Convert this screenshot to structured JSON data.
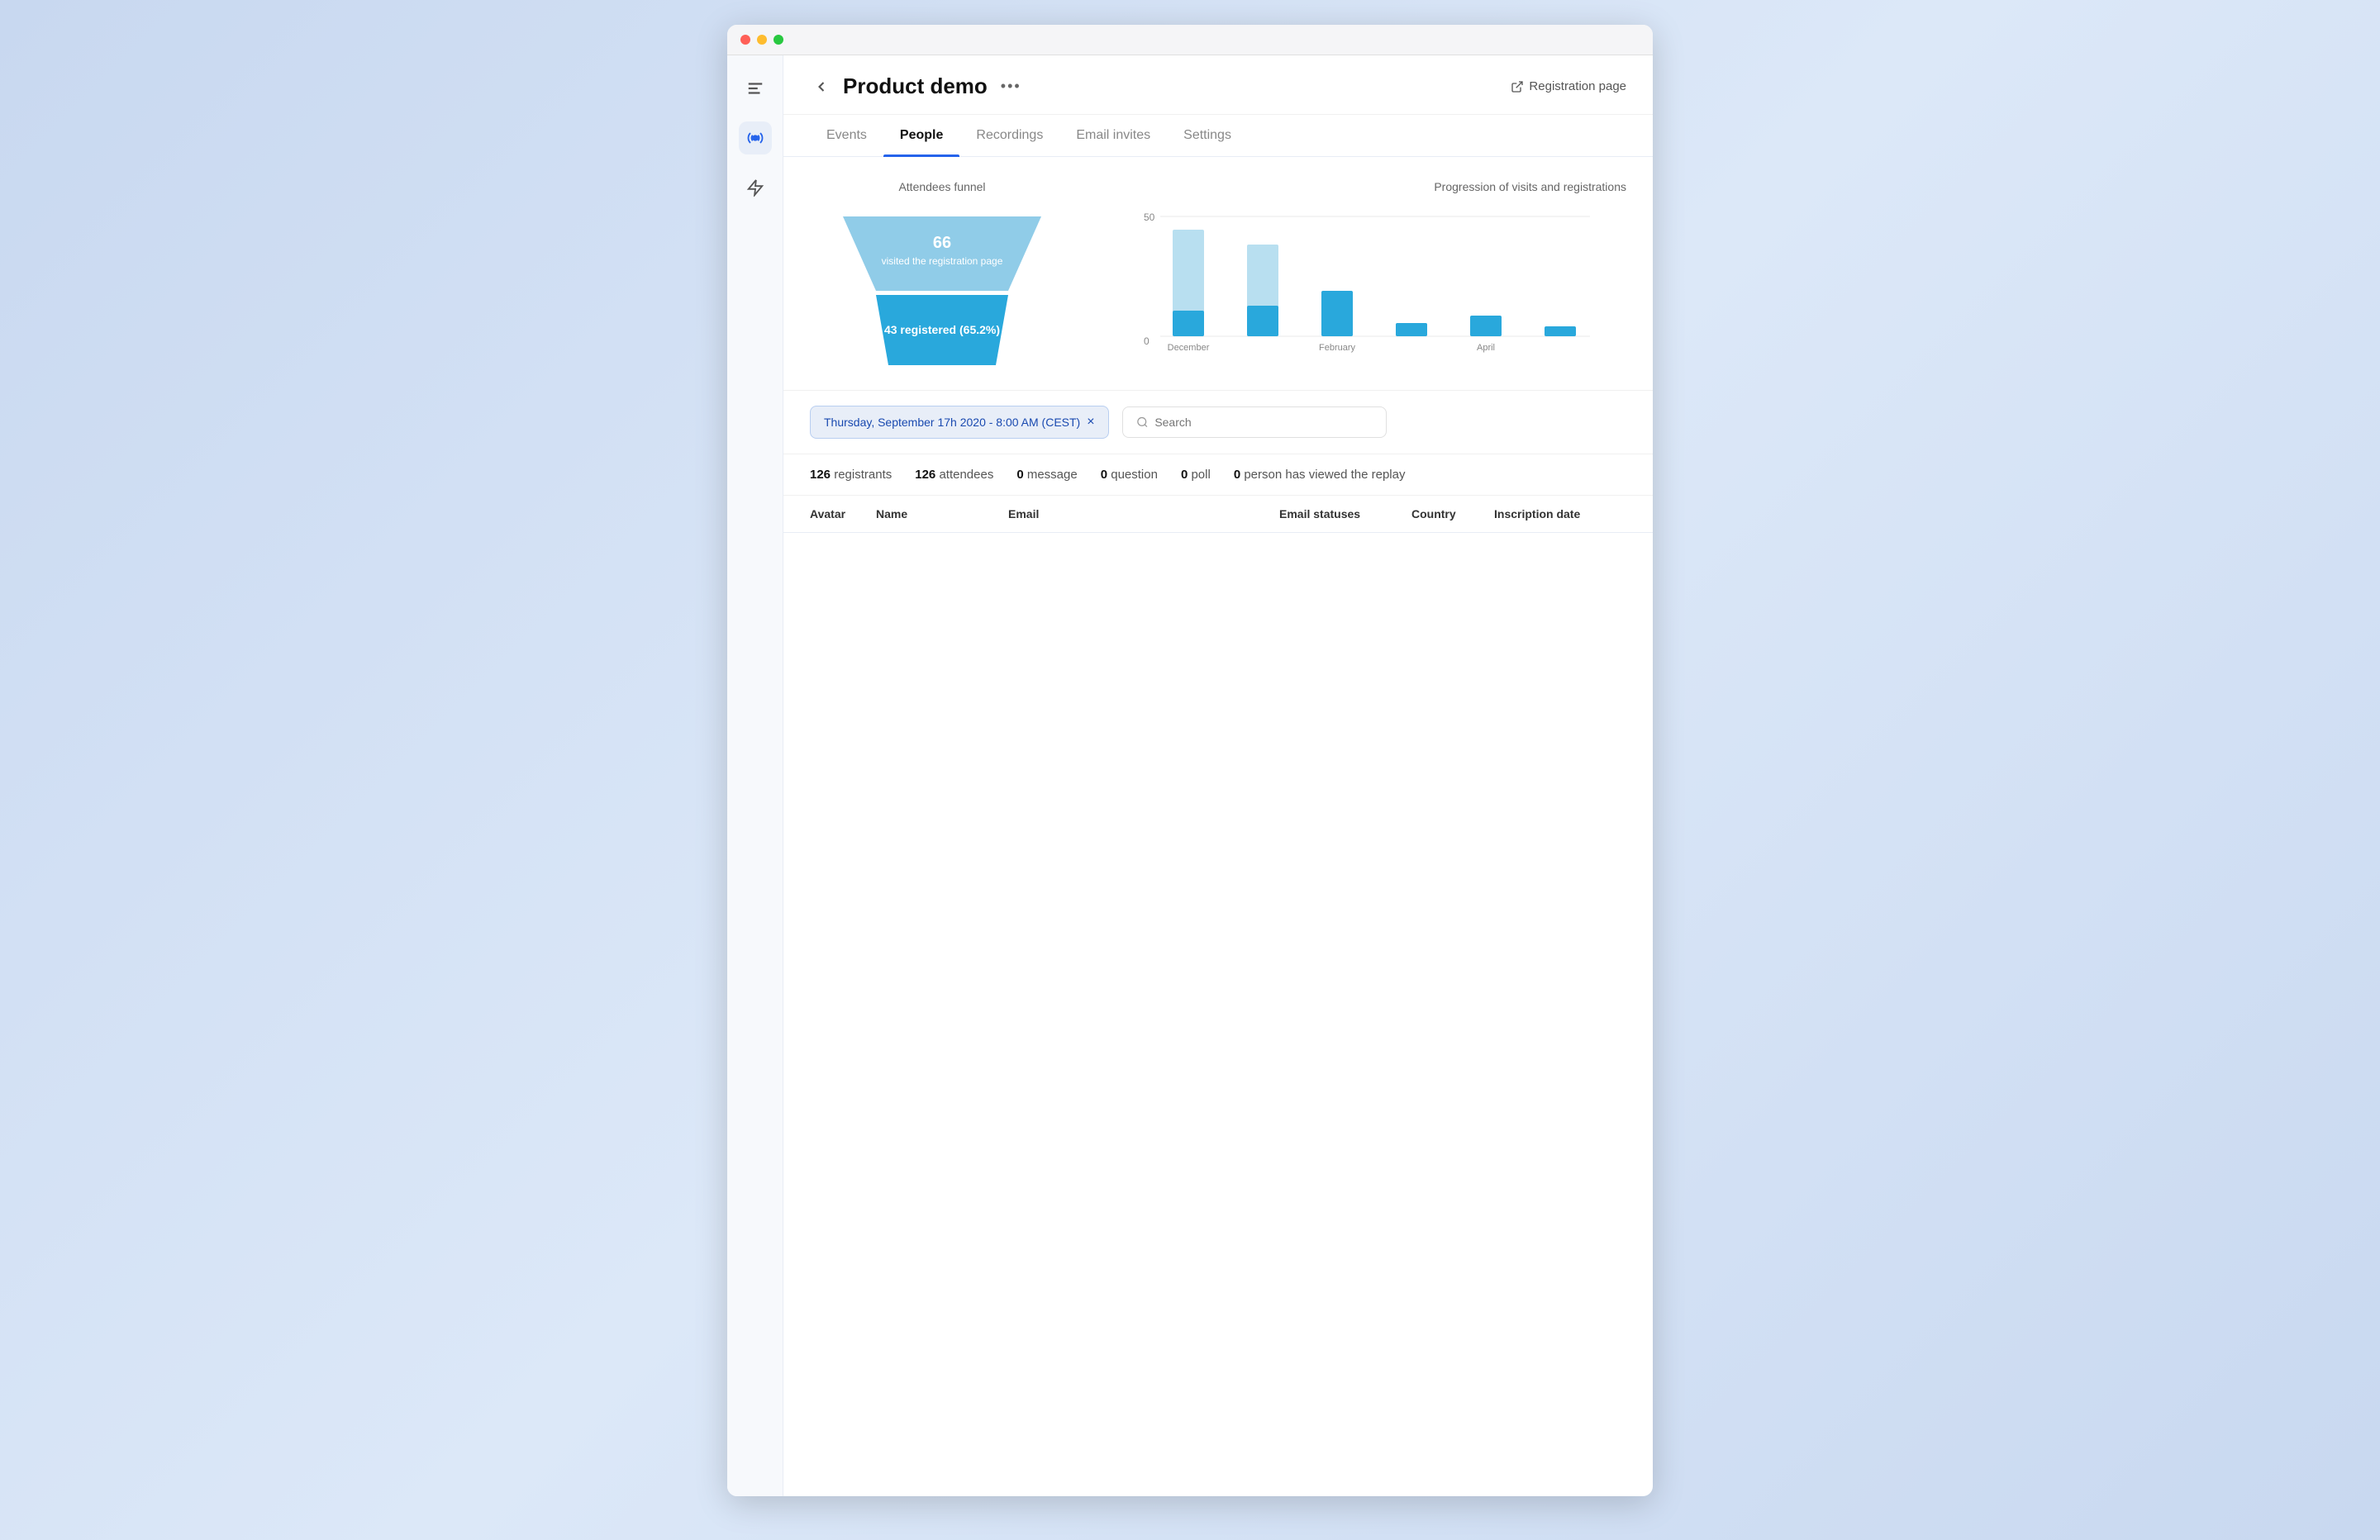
{
  "window": {
    "title": "Product demo"
  },
  "sidebar": {
    "icons": [
      {
        "name": "menu-icon",
        "label": "Menu",
        "active": false
      },
      {
        "name": "broadcast-icon",
        "label": "Broadcast",
        "active": true
      },
      {
        "name": "lightning-icon",
        "label": "Lightning",
        "active": false
      }
    ]
  },
  "header": {
    "back_label": "←",
    "title": "Product demo",
    "more_label": "•••",
    "reg_page_label": "Registration page"
  },
  "tabs": [
    {
      "label": "Events",
      "active": false
    },
    {
      "label": "People",
      "active": true
    },
    {
      "label": "Recordings",
      "active": false
    },
    {
      "label": "Email invites",
      "active": false
    },
    {
      "label": "Settings",
      "active": false
    }
  ],
  "funnel": {
    "title": "Attendees funnel",
    "top_value": "66",
    "top_label": "visited the registration page",
    "bottom_value": "43 registered (65.2%)"
  },
  "chart": {
    "title": "Progression of visits and registrations",
    "y_max": "50",
    "y_zero": "0",
    "bars": [
      {
        "label": "December",
        "visits": 42,
        "registrations": 10
      },
      {
        "label": "",
        "visits": 35,
        "registrations": 12
      },
      {
        "label": "February",
        "visits": 15,
        "registrations": 18
      },
      {
        "label": "",
        "visits": 5,
        "registrations": 5
      },
      {
        "label": "April",
        "visits": 4,
        "registrations": 8
      },
      {
        "label": "",
        "visits": 2,
        "registrations": 4
      }
    ]
  },
  "filter": {
    "tag_label": "Thursday, September 17h 2020 - 8:00 AM (CEST)",
    "tag_close": "×",
    "search_placeholder": "Search"
  },
  "stats": [
    {
      "value": "126",
      "label": "registrants"
    },
    {
      "value": "126",
      "label": "attendees"
    },
    {
      "value": "0",
      "label": "message"
    },
    {
      "value": "0",
      "label": "question"
    },
    {
      "value": "0",
      "label": "poll"
    },
    {
      "value": "0",
      "label": "person has viewed the replay"
    }
  ],
  "table_headers": [
    "Avatar",
    "Name",
    "Email",
    "Email statuses",
    "Country",
    "Inscription date"
  ]
}
